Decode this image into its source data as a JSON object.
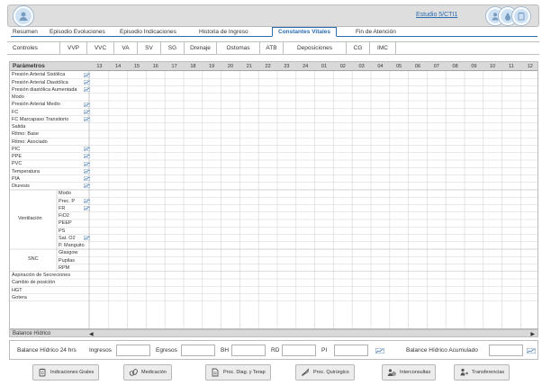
{
  "header": {
    "estudio_link": "Estudio 5/CTI1",
    "logo_icon": "user-avatar-icon",
    "icons": [
      "person-icon",
      "drop-icon",
      "clipboard-icon"
    ]
  },
  "tabs": [
    "Resumen",
    "Episodio Evoluciones",
    "Episodio Indicaciones",
    "Historia de Ingreso",
    "Constantes Vitales",
    "Fin de Atención"
  ],
  "active_tab": "Constantes Vitales",
  "controls": {
    "label": "Controles",
    "buttons": [
      "VVP",
      "VVC",
      "VA",
      "SV",
      "SG",
      "Drenaje",
      "Ostomas",
      "ATB",
      "Deposiciones",
      "CG",
      "IMC"
    ]
  },
  "grid": {
    "title": "Parámetros",
    "hours": [
      "13",
      "14",
      "15",
      "16",
      "17",
      "18",
      "19",
      "20",
      "21",
      "22",
      "23",
      "24",
      "01",
      "02",
      "03",
      "04",
      "05",
      "06",
      "07",
      "08",
      "09",
      "10",
      "11",
      "12"
    ],
    "rows": [
      {
        "label": "Presión Arterial Sistólica",
        "icon": true
      },
      {
        "label": "Presión Arterial Diastólica",
        "icon": true
      },
      {
        "label": "Presión diastólica Aumentada",
        "icon": true
      },
      {
        "label": "Modo",
        "icon": false
      },
      {
        "label": "Presión Arterial Medio",
        "icon": true
      },
      {
        "label": "FC",
        "icon": true
      },
      {
        "label": "FC Marcapaso Transitorio",
        "icon": true
      },
      {
        "label": "Salida",
        "icon": false
      },
      {
        "label": "Ritmo: Base",
        "icon": false
      },
      {
        "label": "Ritmo: Asociado",
        "icon": false
      },
      {
        "label": "PIC",
        "icon": true
      },
      {
        "label": "PPE",
        "icon": true
      },
      {
        "label": "PVC",
        "icon": true
      },
      {
        "label": "Temperatura",
        "icon": true
      },
      {
        "label": "PIA",
        "icon": true
      },
      {
        "label": "Diuresis",
        "icon": true
      }
    ],
    "ventilacion": {
      "label": "Ventilación",
      "items": [
        {
          "label": "Modo",
          "icon": false
        },
        {
          "label": "Prec. P",
          "icon": true
        },
        {
          "label": "FR",
          "icon": true
        },
        {
          "label": "FiO2",
          "icon": false
        },
        {
          "label": "PEEP",
          "icon": false
        },
        {
          "label": "PS",
          "icon": false
        },
        {
          "label": "Sat. O2",
          "icon": true
        },
        {
          "label": "P. Manguito",
          "icon": false
        }
      ]
    },
    "snc": {
      "label": "SNC",
      "items": [
        "Glasgow",
        "Pupilas",
        "RPM"
      ]
    },
    "tail_rows": [
      "Aspiración de Secreciones",
      "Cambio de posición",
      "HGT",
      "Gotera"
    ]
  },
  "balance": {
    "bar_title": "Balance Hídrico",
    "label_24h": "Balance Hídrico 24 hrs",
    "ingresos": "Ingresos",
    "egresos": "Egresos",
    "bh": "BH",
    "rd": "RD",
    "pi": "PI",
    "acumulado": "Balance Hídrico Acumulado"
  },
  "actions": [
    {
      "label": "Indicaciones Grales",
      "icon": "clipboard-icon"
    },
    {
      "label": "Medicación",
      "icon": "pills-icon"
    },
    {
      "label": "Proc. Diag. y Terap",
      "icon": "document-icon"
    },
    {
      "label": "Proc. Quirúrgico",
      "icon": "scalpel-icon"
    },
    {
      "label": "Interconsultas",
      "icon": "consult-icon"
    },
    {
      "label": "Transferencias",
      "icon": "transfer-icon"
    }
  ],
  "colors": {
    "accent": "#2b6cb0",
    "header_bg": "#dedede",
    "grid_header": "#d9d9d9",
    "row_alt": "#f7f7f7"
  }
}
